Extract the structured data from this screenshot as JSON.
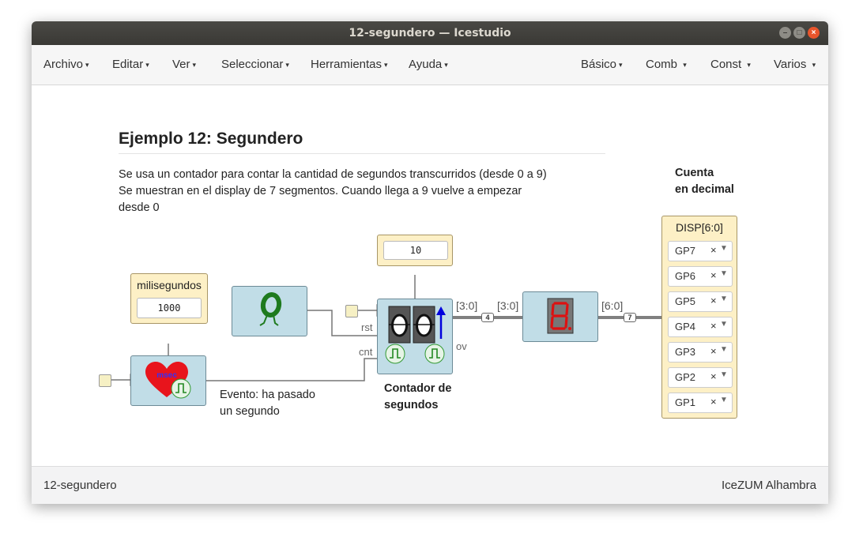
{
  "window": {
    "title": "12-segundero — Icestudio"
  },
  "menu": {
    "left": [
      "Archivo",
      "Editar",
      "Ver",
      "Seleccionar",
      "Herramientas",
      "Ayuda"
    ],
    "right": [
      "Básico",
      "Comb",
      "Const",
      "Varios"
    ]
  },
  "canvas": {
    "heading": "Ejemplo 12: Segundero",
    "description": [
      "Se usa un contador para contar la cantidad de segundos transcurridos (desde 0 a 9)",
      "Se muestran en el display de 7 segmentos. Cuando llega a 9 vuelve a empezar",
      "desde 0"
    ],
    "cuenta_label": [
      "Cuenta",
      "en decimal"
    ],
    "milisegundos": {
      "label": "milisegundos",
      "value": "1000"
    },
    "counter_param": {
      "value": "10"
    },
    "heart_text": "msec",
    "ports": {
      "rst": "rst",
      "cnt": "cnt",
      "ov": "ov"
    },
    "wire_labels": {
      "w1": "[3:0]",
      "w2": "[3:0]",
      "w3": "[6:0]"
    },
    "size_badges": {
      "b1": "4",
      "b2": "7"
    },
    "evento_label": [
      "Evento: ha pasado",
      "un segundo"
    ],
    "contador_label": [
      "Contador de",
      "segundos"
    ],
    "display": {
      "title": "DISP[6:0]",
      "pins": [
        "GP7",
        "GP6",
        "GP5",
        "GP4",
        "GP3",
        "GP2",
        "GP1"
      ],
      "clear_symbol": "×"
    }
  },
  "status": {
    "left": "12-segundero",
    "right": "IceZUM Alhambra"
  },
  "colors": {
    "block": "#c1dde7",
    "param": "#fdf0c6",
    "titlebar": "#3c3b37",
    "close": "#e9552c",
    "wire": "#777777"
  }
}
